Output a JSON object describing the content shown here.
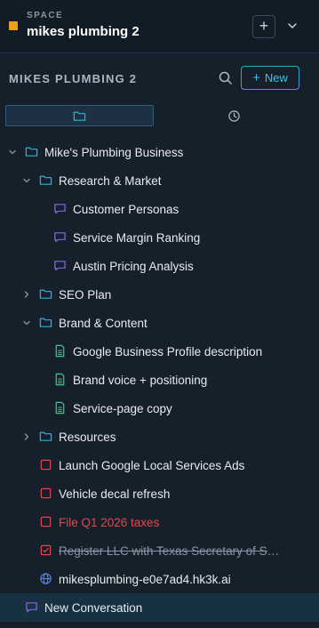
{
  "space": {
    "kicker": "SPACE",
    "name": "mikes plumbing 2",
    "accent": "#f0a020"
  },
  "workspace": {
    "title": "MIKES PLUMBING 2",
    "new_label": "New",
    "new_plus": "+"
  },
  "tabs": [
    {
      "icon": "folder-icon",
      "active": true
    },
    {
      "icon": "clock-icon",
      "active": false
    }
  ],
  "tree": {
    "root": {
      "label": "Mike's Plumbing Business",
      "icon": "folder-icon",
      "expanded": true
    },
    "research": {
      "label": "Research & Market",
      "icon": "folder-icon",
      "expanded": true
    },
    "customer_personas": {
      "label": "Customer Personas",
      "icon": "chat-icon"
    },
    "service_margin": {
      "label": "Service Margin Ranking",
      "icon": "chat-icon"
    },
    "austin_pricing": {
      "label": "Austin Pricing Analysis",
      "icon": "chat-icon"
    },
    "seo_plan": {
      "label": "SEO Plan",
      "icon": "folder-icon",
      "expanded": false
    },
    "brand_content": {
      "label": "Brand & Content",
      "icon": "folder-icon",
      "expanded": true
    },
    "gbp_description": {
      "label": "Google Business Profile description",
      "icon": "document-icon"
    },
    "brand_voice": {
      "label": "Brand voice + positioning",
      "icon": "document-icon"
    },
    "service_page": {
      "label": "Service-page copy",
      "icon": "document-icon"
    },
    "resources": {
      "label": "Resources",
      "icon": "folder-icon",
      "expanded": false
    },
    "task_lsa": {
      "label": "Launch Google Local Services Ads",
      "icon": "checkbox-icon",
      "status": "open"
    },
    "task_decal": {
      "label": "Vehicle decal refresh",
      "icon": "checkbox-icon",
      "status": "open"
    },
    "task_taxes": {
      "label": "File Q1 2026 taxes",
      "icon": "checkbox-icon",
      "status": "overdue"
    },
    "task_llc": {
      "label": "Register LLC with Texas Secretary of State",
      "icon": "checkbox-checked-icon",
      "status": "done"
    },
    "site_link": {
      "label": "mikesplumbing-e0e7ad4.hk3k.ai",
      "icon": "globe-icon"
    },
    "new_conversation": {
      "label": "New Conversation",
      "icon": "chat-icon",
      "selected": true
    }
  },
  "colors": {
    "folder": "#2ab4dc",
    "chat": "#8a66e8",
    "document": "#3cc48a",
    "task_red": "#e0484e",
    "globe": "#5a8ce8",
    "background": "#16202b"
  }
}
